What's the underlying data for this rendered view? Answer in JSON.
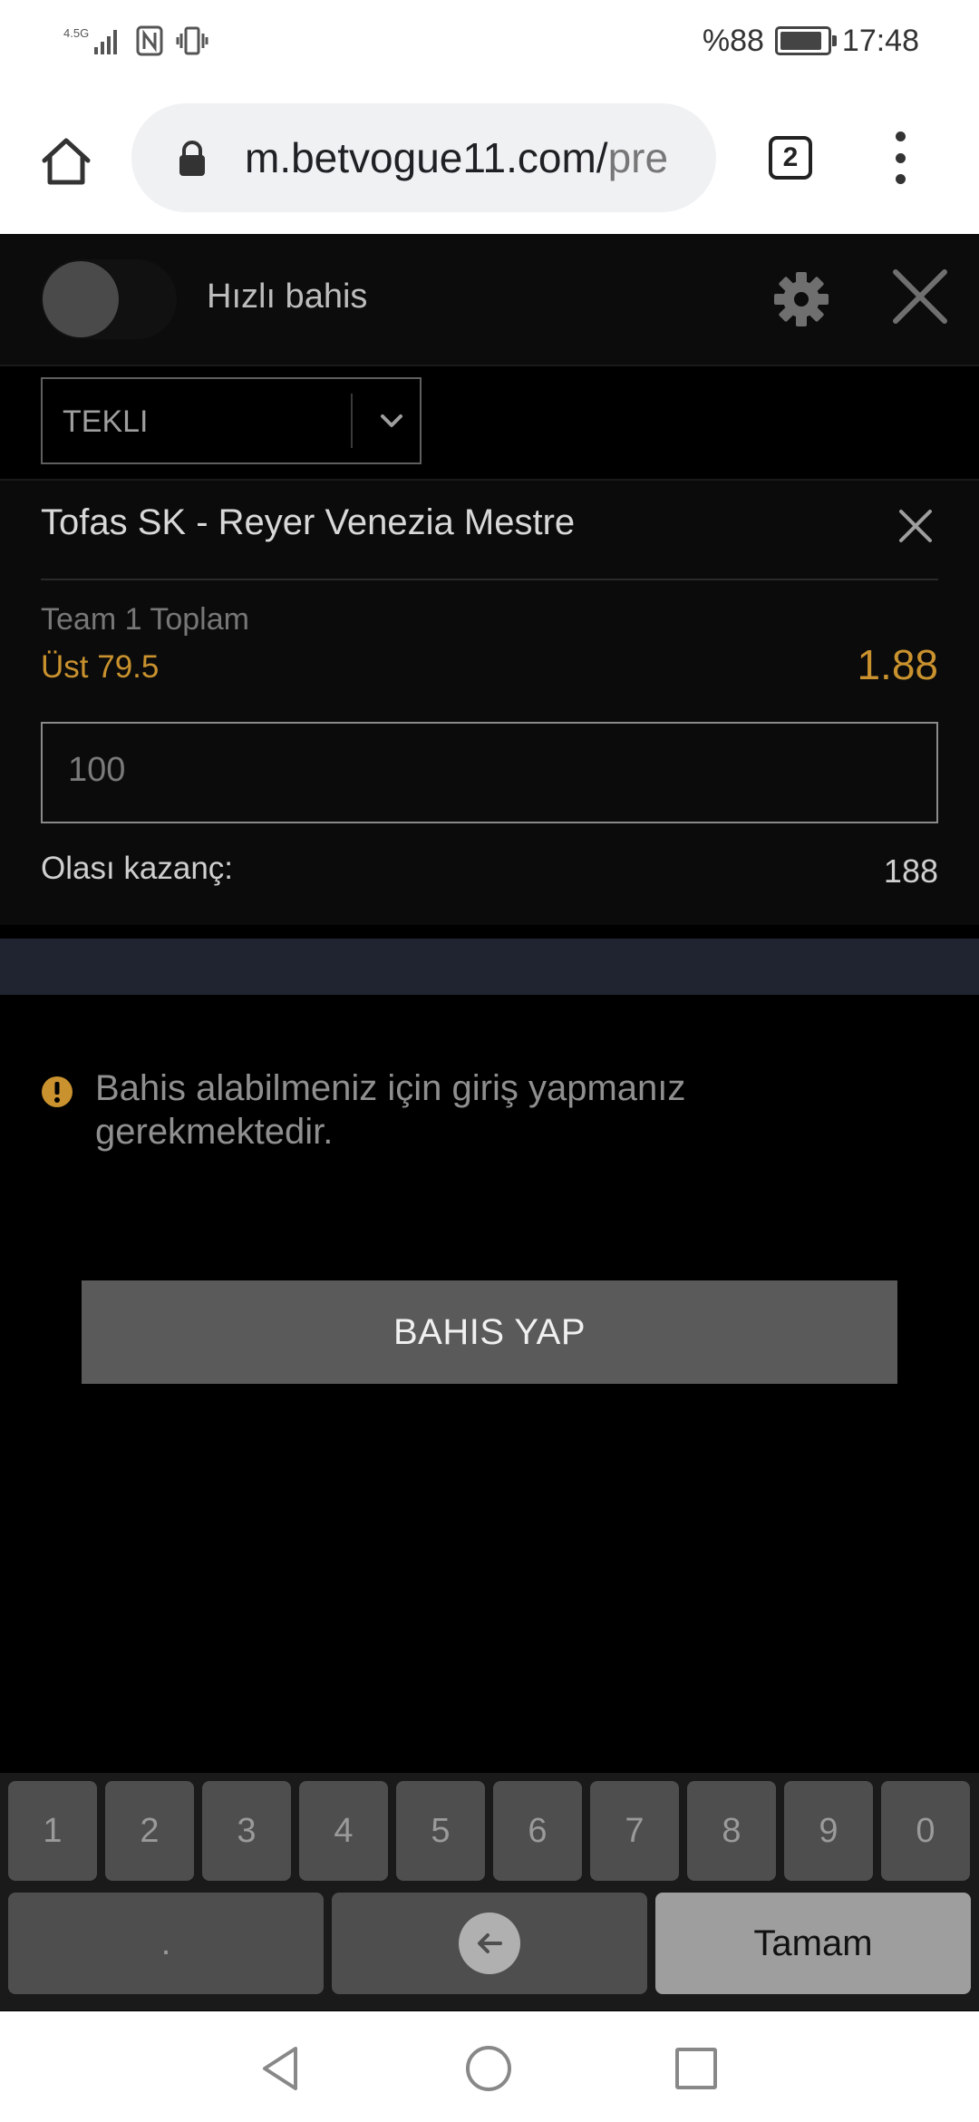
{
  "status_bar": {
    "network": "4.5G",
    "battery_percent": "%88",
    "battery_level": 0.88,
    "time": "17:48"
  },
  "browser": {
    "url_visible": "m.betvogue11.com/",
    "url_faded": "pre",
    "tab_count": "2"
  },
  "header": {
    "quick_bet_label": "Hızlı bahis",
    "quick_bet_enabled": false
  },
  "bet_type": {
    "selected": "TEKLI"
  },
  "bet": {
    "match": "Tofas SK - Reyer Venezia Mestre",
    "market": "Team 1 Toplam",
    "selection": "Üst 79.5",
    "odds": "1.88",
    "stake": "100",
    "potential_win_label": "Olası kazanç:",
    "potential_win_value": "188"
  },
  "warning": {
    "text": "Bahis alabilmeniz için giriş yapmanız gerekmektedir."
  },
  "place_bet_label": "BAHIS YAP",
  "keyboard": {
    "digits": [
      "1",
      "2",
      "3",
      "4",
      "5",
      "6",
      "7",
      "8",
      "9",
      "0"
    ],
    "decimal": ".",
    "done_label": "Tamam"
  },
  "colors": {
    "accent_odds": "#c9922e",
    "background": "#000000",
    "band": "#1f2430"
  },
  "icons": [
    "home-icon",
    "lock-icon",
    "tabs-icon",
    "menu-icon",
    "gear-icon",
    "close-icon",
    "chevron-down-icon",
    "warning-icon",
    "backspace-icon",
    "nav-back-icon",
    "nav-home-icon",
    "nav-recent-icon"
  ]
}
